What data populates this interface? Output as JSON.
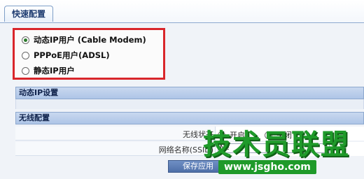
{
  "tab": {
    "label": "快速配置"
  },
  "connection_types": [
    {
      "label": "动态IP用户 (Cable Modem)",
      "checked": true
    },
    {
      "label": "PPPoE用户(ADSL)",
      "checked": false
    },
    {
      "label": "静态IP用户",
      "checked": false
    }
  ],
  "sections": {
    "dynamic_ip": "动态IP设置",
    "wireless": "无线配置"
  },
  "wireless": {
    "status_label": "无线状态",
    "status_options": [
      {
        "label": "开启",
        "checked": true
      },
      {
        "label": "关闭",
        "checked": false
      }
    ],
    "ssid_label": "网络名称(SSID)",
    "ssid_value": "Ne"
  },
  "save_button": {
    "label": "保存应用"
  },
  "watermark": {
    "title": "技术员联盟",
    "url": "www.jsgho.com"
  },
  "colors": {
    "highlight_border": "#d9262b",
    "section_bar": "#aec5e7",
    "watermark_green": "#1f9a2a"
  }
}
